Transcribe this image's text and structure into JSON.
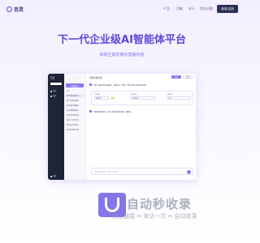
{
  "nav": {
    "brand": "百灵",
    "links": [
      "产品",
      "功能",
      "关于",
      "常见问题"
    ],
    "active_link": "产品",
    "login_label": "登录/注册"
  },
  "hero": {
    "title": "下一代企业级AI智能体平台",
    "subtitle": "高效生成定制化营销内容"
  },
  "app": {
    "sidebar_brand": "百灵",
    "sidebar_items": [
      "首页",
      "应用"
    ],
    "sidebar_bottom": "设置",
    "list_button": "新建对话",
    "list_label": "最近",
    "list_items": [
      "营销文案生成",
      "产品卖点提炼",
      "社媒内容策划",
      "品牌故事撰写",
      "活动方案生成",
      "用户评论分析",
      "竞品分析报告",
      "邮件营销内容"
    ],
    "chat_title": "营销文案生成",
    "header_primary": "分享",
    "header_secondary": "导出",
    "messages": [
      "你好！我是营销文案助手，请填写以下信息，我将为您生成定制化内容。",
      "已收到您的需求，正在为您生成营销文案，请稍候……"
    ],
    "form_fields": [
      {
        "label": "产品名称",
        "value": "智能手表"
      },
      {
        "label": "目标人群",
        "value": "年轻白领"
      },
      {
        "label": "文案风格",
        "value": "活泼"
      }
    ],
    "form_tag": "必填",
    "input_placeholder": "请输入您的问题，按 Enter 发送"
  },
  "watermark": {
    "title": "自动秒收录",
    "subtitle": "快上链接 ↔ 来访一次 ↔ 自动收录"
  },
  "colors": {
    "brand": "#5a4ad8",
    "accent": "#8b79ee",
    "sidebar": "#1f2438",
    "login": "#2b2f54"
  }
}
